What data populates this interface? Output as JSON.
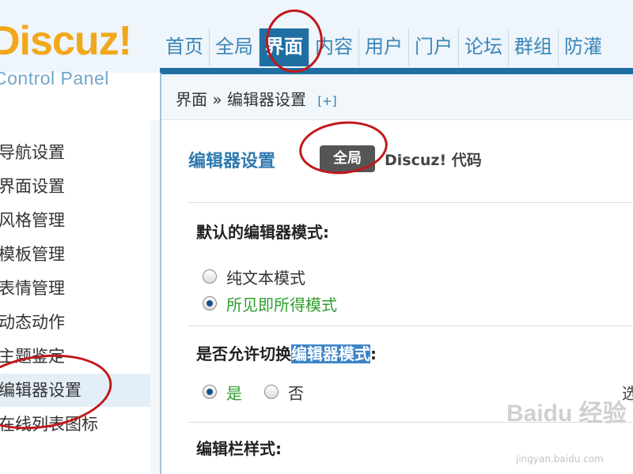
{
  "header": {
    "logo": "Discuz!",
    "logo_sub": "Control Panel",
    "nav": [
      "首页",
      "全局",
      "界面",
      "内容",
      "用户",
      "门户",
      "论坛",
      "群组",
      "防灌"
    ]
  },
  "breadcrumb": {
    "text": "界面 » 编辑器设置",
    "expand": "[+]"
  },
  "sidebar": {
    "items": [
      "导航设置",
      "界面设置",
      "风格管理",
      "模板管理",
      "表情管理",
      "动态动作",
      "主题鉴定",
      "编辑器设置",
      "在线列表图标"
    ]
  },
  "main": {
    "title": "编辑器设置",
    "tab_global": "全局",
    "tab_code": "Discuz! 代码",
    "field1_label": "默认的编辑器模式:",
    "field1_options": [
      "纯文本模式",
      "所见即所得模式"
    ],
    "field2_label_pre": "是否允许切换",
    "field2_label_hl": "编辑器模式",
    "field2_label_post": ":",
    "field2_options": [
      "是",
      "否"
    ],
    "field2_hint": "选",
    "field3_label": "编辑栏样式:"
  },
  "watermark": {
    "text": "Baidu 经验",
    "sub": "jingyan.baidu.com"
  },
  "colors": {
    "accent": "#1f6fa3",
    "annotation": "#c0181b",
    "selected_option": "#2e9e2e"
  }
}
